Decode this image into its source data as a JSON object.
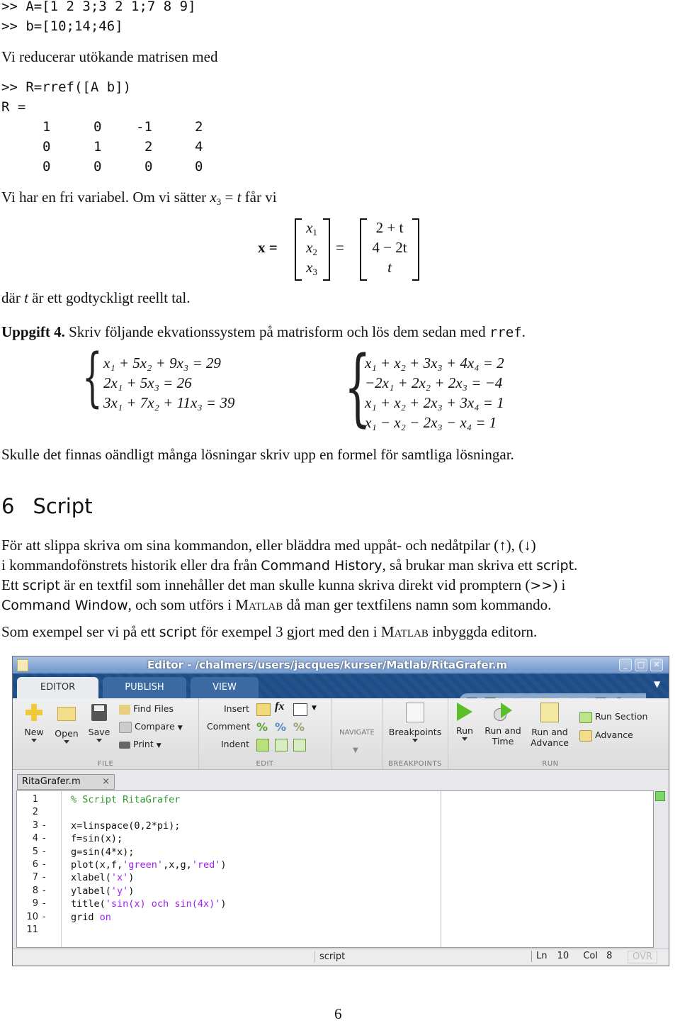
{
  "commands": {
    "line1": ">> A=[1 2 3;3 2 1;7 8 9]",
    "line2": ">> b=[10;14;46]",
    "line3": ">> R=rref([A b])",
    "line4": "R ="
  },
  "para_reduce": "Vi reducerar utökande matrisen med",
  "rref_matrix": [
    [
      "1",
      "0",
      "-1",
      "2"
    ],
    [
      "0",
      "1",
      "2",
      "4"
    ],
    [
      "0",
      "0",
      "0",
      "0"
    ]
  ],
  "para_free_var": {
    "before": "Vi har en fri variabel. Om vi sätter ",
    "var": "x",
    "sub": "3",
    "mid": " = ",
    "t": "t",
    "after": " får vi"
  },
  "solution_vector": {
    "lhs": "x =",
    "vars": [
      {
        "name": "x",
        "sub": "1"
      },
      {
        "name": "x",
        "sub": "2"
      },
      {
        "name": "x",
        "sub": "3"
      }
    ],
    "eq": "=",
    "values": [
      "2 + t",
      "4 − 2t",
      "t"
    ]
  },
  "para_t": {
    "before": "där ",
    "t": "t",
    "after": " är ett godtyckligt reellt tal."
  },
  "task4": {
    "label": "Uppgift 4.",
    "text": " Skriv följande ekvationssystem på matrisform och lös dem sedan med ",
    "code": "rref",
    "end": "."
  },
  "system1": [
    "x₁ + 5x₂ + 9x₃ = 29",
    "2x₁ + 5x₃ = 26",
    "3x₁ + 7x₂ + 11x₃ = 39"
  ],
  "system2": [
    "x₁ + x₂ + 3x₃ + 4x₄ = 2",
    "−2x₁ + 2x₂ + 2x₃ = −4",
    "x₁ + x₂ + 2x₃ + 3x₄ = 1",
    "x₁ − x₂ − 2x₃ − x₄ = 1"
  ],
  "para_infinite": "Skulle det finnas oändligt många lösningar skriv upp en formel för samtliga lösningar.",
  "section": {
    "number": "6",
    "title": "Script"
  },
  "para_script": {
    "l1": "För att slippa skriva om sina kommandon, eller bläddra med uppåt- och nedåtpilar (↑), (↓)",
    "l2a": "i kommandofönstrets historik eller dra från ",
    "l2b": "Command History",
    "l2c": ", så brukar man skriva ett ",
    "l2d": "script",
    "l2e": ".",
    "l3a": "Ett ",
    "l3b": "script",
    "l3c": " är en textfil som innehåller det man skulle kunna skriva direkt vid promptern (",
    "l3d": ">>",
    "l3e": ") i",
    "l4a": "Command Window",
    "l4b": ", och som utförs i ",
    "l4c": "Matlab",
    "l4d": " då man ger textfilens namn som kommando."
  },
  "para_example": {
    "a": "Som exempel ser vi på ett ",
    "b": "script",
    "c": " för exempel 3 gjort med den i ",
    "d": "Matlab",
    "e": " inbyggda editorn."
  },
  "matlab": {
    "window_title": "Editor - /chalmers/users/jacques/kurser/Matlab/RitaGrafer.m",
    "tabs": [
      "EDITOR",
      "PUBLISH",
      "VIEW"
    ],
    "file_group": {
      "label": "FILE",
      "new": "New",
      "open": "Open",
      "save": "Save",
      "find_files": "Find Files",
      "compare": "Compare",
      "print": "Print"
    },
    "edit_group": {
      "label": "EDIT",
      "insert": "Insert",
      "comment": "Comment",
      "indent": "Indent",
      "fx": "fx"
    },
    "navigate_group": {
      "label": "NAVIGATE"
    },
    "breakpoints_group": {
      "label": "BREAKPOINTS",
      "breakpoints": "Breakpoints"
    },
    "run_group": {
      "label": "RUN",
      "run": "Run",
      "run_and_time_1": "Run and",
      "run_and_time_2": "Time",
      "run_and_advance_1": "Run and",
      "run_and_advance_2": "Advance",
      "run_section": "Run Section",
      "advance": "Advance"
    },
    "doc_tab": "RitaGrafer.m",
    "doc_tab_close": "×",
    "code_lines": [
      {
        "n": "1",
        "dash": "",
        "parts": [
          {
            "t": "% Script RitaGrafer",
            "c": "cmt"
          }
        ]
      },
      {
        "n": "2",
        "dash": "",
        "parts": []
      },
      {
        "n": "3",
        "dash": "-",
        "parts": [
          {
            "t": "x=linspace(0,2*pi);",
            "c": ""
          }
        ]
      },
      {
        "n": "4",
        "dash": "-",
        "parts": [
          {
            "t": "f=sin(x);",
            "c": ""
          }
        ]
      },
      {
        "n": "5",
        "dash": "-",
        "parts": [
          {
            "t": "g=sin(4*x);",
            "c": ""
          }
        ]
      },
      {
        "n": "6",
        "dash": "-",
        "parts": [
          {
            "t": "plot(x,f,",
            "c": ""
          },
          {
            "t": "'green'",
            "c": "str"
          },
          {
            "t": ",x,g,",
            "c": ""
          },
          {
            "t": "'red'",
            "c": "str"
          },
          {
            "t": ")",
            "c": ""
          }
        ]
      },
      {
        "n": "7",
        "dash": "-",
        "parts": [
          {
            "t": "xlabel(",
            "c": ""
          },
          {
            "t": "'x'",
            "c": "str"
          },
          {
            "t": ")",
            "c": ""
          }
        ]
      },
      {
        "n": "8",
        "dash": "-",
        "parts": [
          {
            "t": "ylabel(",
            "c": ""
          },
          {
            "t": "'y'",
            "c": "str"
          },
          {
            "t": ")",
            "c": ""
          }
        ]
      },
      {
        "n": "9",
        "dash": "-",
        "parts": [
          {
            "t": "title(",
            "c": ""
          },
          {
            "t": "'sin(x) och sin(4x)'",
            "c": "str"
          },
          {
            "t": ")",
            "c": ""
          }
        ]
      },
      {
        "n": "10",
        "dash": "-",
        "parts": [
          {
            "t": "grid ",
            "c": ""
          },
          {
            "t": "on",
            "c": "kw"
          }
        ]
      },
      {
        "n": "11",
        "dash": "",
        "parts": []
      }
    ],
    "status": {
      "type": "script",
      "ln_label": "Ln",
      "ln": "10",
      "col_label": "Col",
      "col": "8",
      "ovr": "OVR"
    },
    "colors": {
      "titlebar": "#7a9dd0",
      "tabstrip": "#1e4c85",
      "comment": "#2e9a2e",
      "string": "#a020f0",
      "run_green": "#5cbf2a"
    }
  },
  "page_number": "6"
}
